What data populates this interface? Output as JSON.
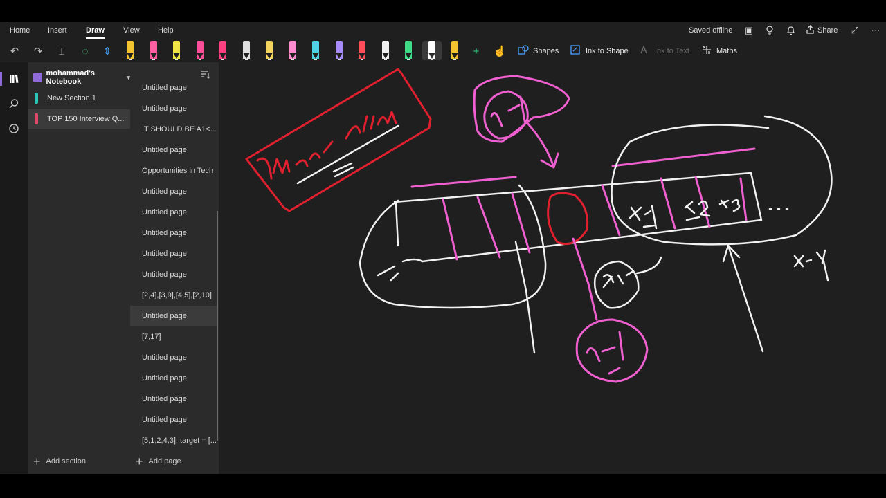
{
  "ribbon": {
    "tabs": [
      "Home",
      "Insert",
      "Draw",
      "View",
      "Help"
    ],
    "active_tab": "Draw",
    "status": "Saved offline",
    "share_label": "Share"
  },
  "toolbar": {
    "shapes_label": "Shapes",
    "ink_to_shape_label": "Ink to Shape",
    "ink_to_text_label": "Ink to Text",
    "maths_label": "Maths",
    "pens": [
      {
        "icon": "highlighter-yellow-icon",
        "color": "#f4c430"
      },
      {
        "icon": "pen-pink-icon",
        "color": "#ff5fa2"
      },
      {
        "icon": "highlighter-yellow-icon",
        "color": "#f0e442"
      },
      {
        "icon": "pen-pink-icon",
        "color": "#ff4d9a"
      },
      {
        "icon": "highlighter-pink-icon",
        "color": "#ff3f7f"
      },
      {
        "icon": "pen-white-icon",
        "color": "#e0e0e0"
      },
      {
        "icon": "pen-yellow-icon",
        "color": "#f4d35e"
      },
      {
        "icon": "pen-pink-icon",
        "color": "#ff8ad0"
      },
      {
        "icon": "pen-cyan-icon",
        "color": "#4fd1e8"
      },
      {
        "icon": "pen-purple-icon",
        "color": "#a78bfa"
      },
      {
        "icon": "pen-red-icon",
        "color": "#ff4d5a"
      },
      {
        "icon": "pen-white-icon",
        "color": "#f0f0f0"
      },
      {
        "icon": "pen-green-icon",
        "color": "#3ddc84"
      },
      {
        "icon": "pen-white-icon",
        "color": "#ffffff"
      },
      {
        "icon": "pen-yellow-icon",
        "color": "#f4c430"
      }
    ]
  },
  "notebook": {
    "name": "mohammad's Notebook",
    "sections": [
      {
        "label": "New Section 1",
        "color": "#2ec4b6",
        "active": false
      },
      {
        "label": "TOP 150 Interview Q...",
        "color": "#e0476b",
        "active": true
      }
    ],
    "add_section_label": "Add section"
  },
  "pages": {
    "items": [
      {
        "label": "Untitled page",
        "active": false
      },
      {
        "label": "Untitled page",
        "active": false
      },
      {
        "label": "IT SHOULD BE A1<...",
        "active": false
      },
      {
        "label": "Untitled page",
        "active": false
      },
      {
        "label": "Opportunities in Tech",
        "active": false
      },
      {
        "label": "Untitled page",
        "active": false
      },
      {
        "label": "Untitled page",
        "active": false
      },
      {
        "label": "Untitled page",
        "active": false
      },
      {
        "label": "Untitled page",
        "active": false
      },
      {
        "label": "Untitled page",
        "active": false
      },
      {
        "label": "[2,4],[3,9],[4,5],[2,10]",
        "active": false
      },
      {
        "label": "Untitled page",
        "active": true
      },
      {
        "label": "[7,17]",
        "active": false
      },
      {
        "label": "Untitled page",
        "active": false
      },
      {
        "label": "Untitled page",
        "active": false
      },
      {
        "label": "Untitled page",
        "active": false
      },
      {
        "label": "Untitled page",
        "active": false
      },
      {
        "label": "[5,1,2,4,3], target = [...",
        "active": false
      }
    ],
    "add_page_label": "Add page"
  },
  "colors": {
    "ink_red": "#e0202e",
    "ink_pink": "#ef5fd0",
    "ink_white": "#f2f2f2",
    "accent_purple": "#8e6bd8"
  },
  "canvas": {
    "ink_labels": [
      "max sum",
      "n-1",
      "x-1",
      "x-2",
      "x-3",
      "...",
      "x-y",
      "x",
      "n-1"
    ]
  }
}
